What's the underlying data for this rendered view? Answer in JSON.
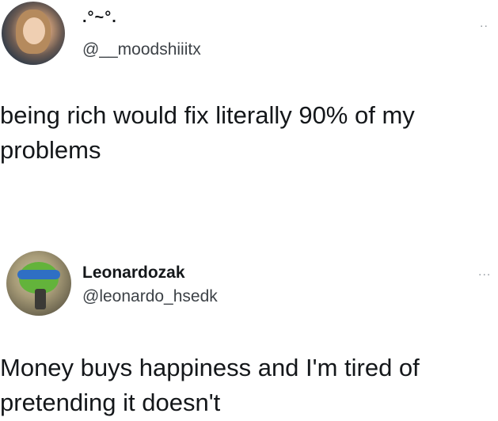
{
  "tweets": [
    {
      "display_name": ".°~°.",
      "handle": "@__moodshiiitx",
      "text": "being rich would fix literally 90% of my problems",
      "more_icon": "..",
      "avatar_icon": "user-avatar-photo"
    },
    {
      "display_name": "Leonardozak",
      "handle": "@leonardo_hsedk",
      "text": "Money buys happiness and I'm tired of pretending it doesn't",
      "more_icon": "...",
      "avatar_icon": "ninja-turtle-avatar"
    }
  ]
}
